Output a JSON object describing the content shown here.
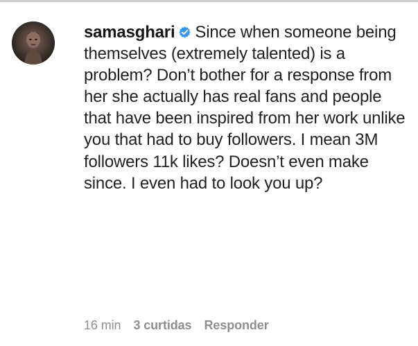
{
  "comment": {
    "username": "samasghari",
    "verified_icon": "verified-badge-icon",
    "text": "Since when someone being themselves (extremely talented) is a problem? Don’t bother for a response from her she actually has real fans and people that have been inspired from her work unlike you that had to buy followers. I mean 3M followers 11k likes? Doesn’t even make since. I even had to look you up?",
    "avatar_icon": "profile-avatar"
  },
  "meta": {
    "time": "16 min",
    "likes": "3 curtidas",
    "reply": "Responder"
  },
  "colors": {
    "text": "#1f1f1f",
    "meta_text": "#8e8e8e",
    "verified_blue": "#3897f0"
  }
}
